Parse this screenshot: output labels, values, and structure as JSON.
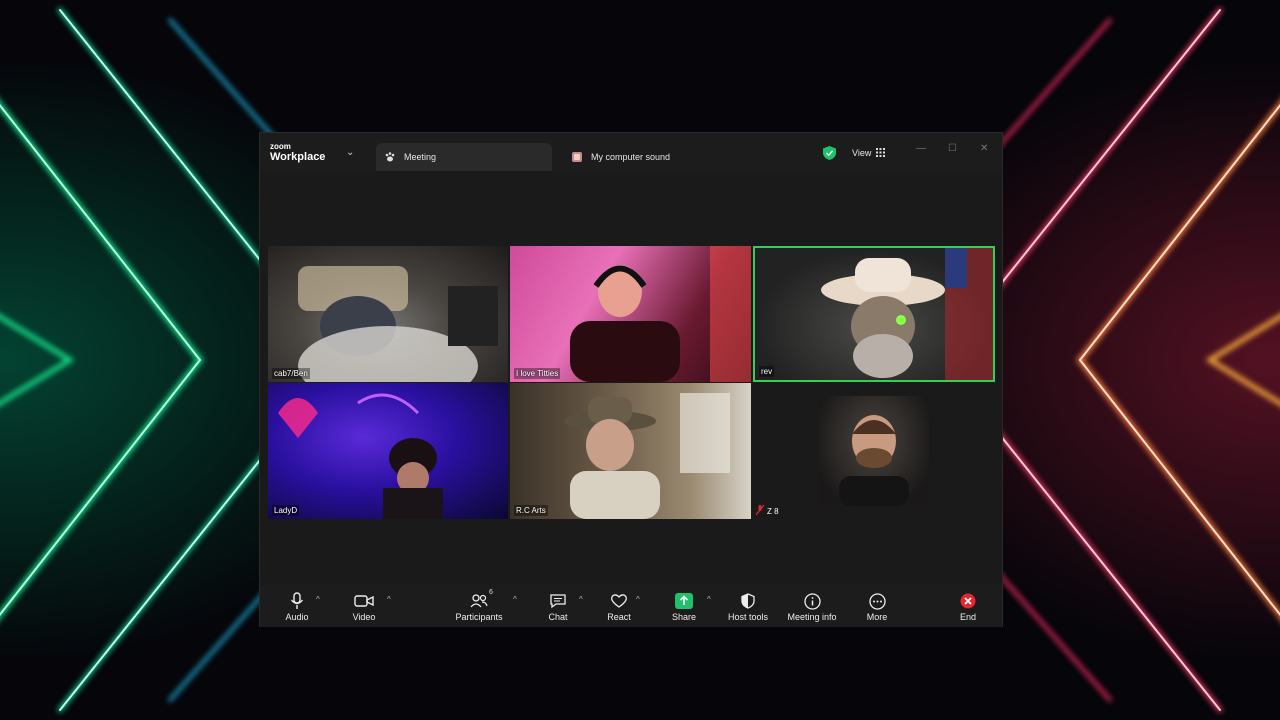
{
  "app": {
    "brand_small": "zoom",
    "brand_name": "Workplace",
    "tabs": [
      {
        "label": "Meeting",
        "active": true
      },
      {
        "label": "My computer sound",
        "active": false
      }
    ],
    "view_label": "View"
  },
  "participants": [
    {
      "name": "cab7/Ben"
    },
    {
      "name": "I love Titties"
    },
    {
      "name": "rev",
      "speaking": true
    },
    {
      "name": "LadyD"
    },
    {
      "name": "R.C Arts"
    },
    {
      "name": "Z 8",
      "muted": true
    }
  ],
  "toolbar": {
    "audio": "Audio",
    "video": "Video",
    "participants": "Participants",
    "participants_count": "6",
    "chat": "Chat",
    "react": "React",
    "share": "Share",
    "host_tools": "Host tools",
    "meeting_info": "Meeting info",
    "more": "More",
    "end": "End"
  },
  "colors": {
    "speaking_border": "#30d158",
    "share_green": "#1fc16b",
    "end_red": "#e0282e"
  }
}
